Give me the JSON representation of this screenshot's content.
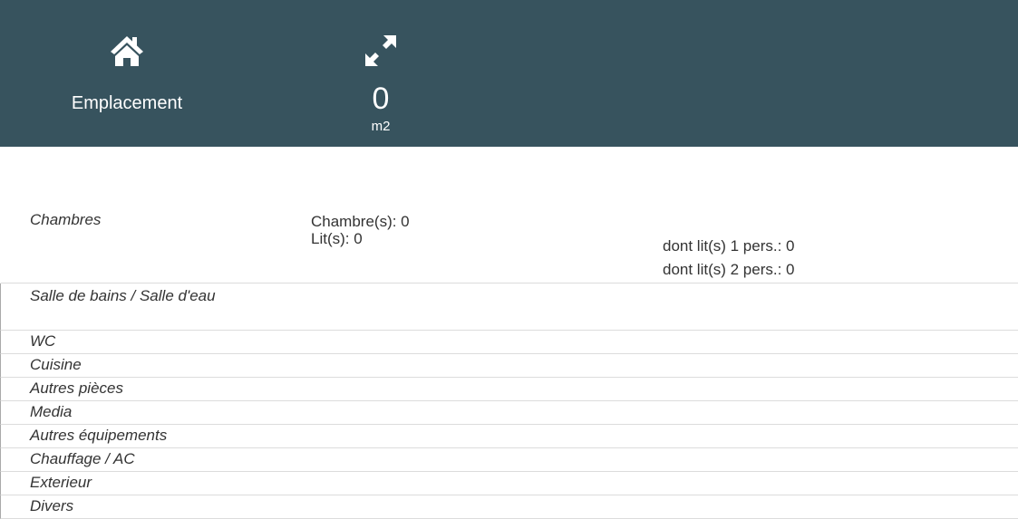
{
  "header": {
    "location": {
      "icon": "home-icon",
      "label": "Emplacement"
    },
    "area": {
      "icon": "expand-icon",
      "value": "0",
      "unit": "m2"
    }
  },
  "rooms": {
    "chambres": {
      "label": "Chambres",
      "chambres_text": "Chambre(s): 0",
      "lits_text": "Lit(s):  0",
      "lit1_text": "dont lit(s) 1 pers.: 0",
      "lit2_text": "dont lit(s) 2 pers.: 0"
    },
    "items": [
      "Salle de bains / Salle d'eau",
      "WC",
      "Cuisine",
      "Autres pièces",
      "Media",
      "Autres équipements",
      "Chauffage / AC",
      "Exterieur",
      "Divers"
    ]
  },
  "colors": {
    "header_bg": "#37535e",
    "header_text": "#ffffff",
    "divider": "#dcdcdc"
  }
}
